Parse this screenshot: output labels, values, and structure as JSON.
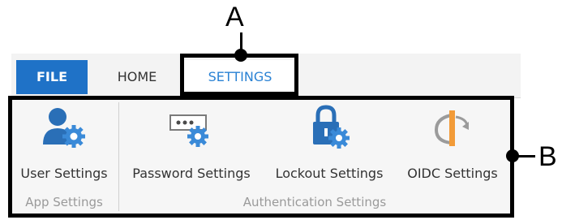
{
  "ribbon": {
    "tabs": [
      {
        "label": "FILE"
      },
      {
        "label": "HOME"
      },
      {
        "label": "SETTINGS"
      }
    ],
    "groups": [
      {
        "label": "App Settings",
        "commands": [
          {
            "label": "User Settings",
            "icon": "user-settings-icon"
          }
        ]
      },
      {
        "label": "Authentication Settings",
        "commands": [
          {
            "label": "Password Settings",
            "icon": "password-settings-icon"
          },
          {
            "label": "Lockout Settings",
            "icon": "lockout-settings-icon"
          },
          {
            "label": "OIDC Settings",
            "icon": "oidc-settings-icon"
          }
        ]
      }
    ]
  },
  "annotations": {
    "a": "A",
    "b": "B"
  },
  "colors": {
    "file_tab": "#1f72c7",
    "active_tab_text": "#2a82d4",
    "icon_blue": "#2a6fb7",
    "gear_blue": "#3a8ad8",
    "oidc_orange": "#f29b38",
    "oidc_gray": "#9b9b9b"
  }
}
